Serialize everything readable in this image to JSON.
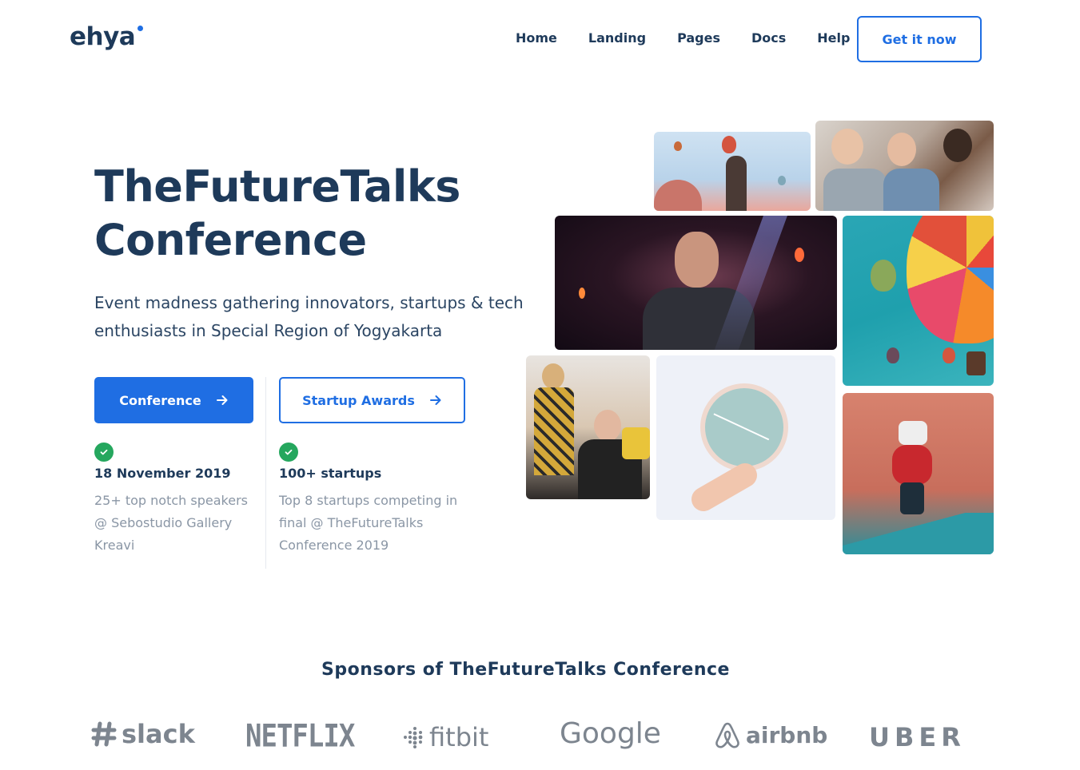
{
  "brand": {
    "name": "ehya",
    "accent": "#1f6ee3",
    "text": "#1e3a5a"
  },
  "nav": {
    "items": [
      "Home",
      "Landing",
      "Pages",
      "Docs",
      "Help"
    ],
    "cta": "Get it now"
  },
  "hero": {
    "title_line1": "TheFutureTalks",
    "title_line2": "Conference",
    "description_line1": "Event madness gathering innovators, startups & tech",
    "description_line2": "enthusiasts in Special Region of Yogyakarta",
    "primary_button": "Conference",
    "secondary_button": "Startup Awards"
  },
  "features": [
    {
      "title": "18 November 2019",
      "desc_lines": [
        "25+ top notch speakers",
        "@ Sebostudio Gallery",
        "Kreavi"
      ]
    },
    {
      "title": "100+ startups",
      "desc_lines": [
        "Top 8 startups competing in",
        "final @ TheFutureTalks",
        "Conference 2019"
      ]
    }
  ],
  "sponsors": {
    "title": "Sponsors of TheFutureTalks Conference",
    "logos": [
      "slack",
      "NETFLIX",
      "fitbit",
      "Google",
      "airbnb",
      "UBER"
    ],
    "logo_color": "#7d858f"
  },
  "gallery": {
    "photos": [
      "balloons-sky-photo",
      "friends-laughing-photo",
      "speaker-stage-photo",
      "hot-air-balloon-photo",
      "two-people-desk-photo",
      "wall-clock-photo",
      "vr-headset-court-photo"
    ]
  },
  "icons": {
    "arrow": "arrow-right-icon",
    "check": "check-circle-icon"
  }
}
